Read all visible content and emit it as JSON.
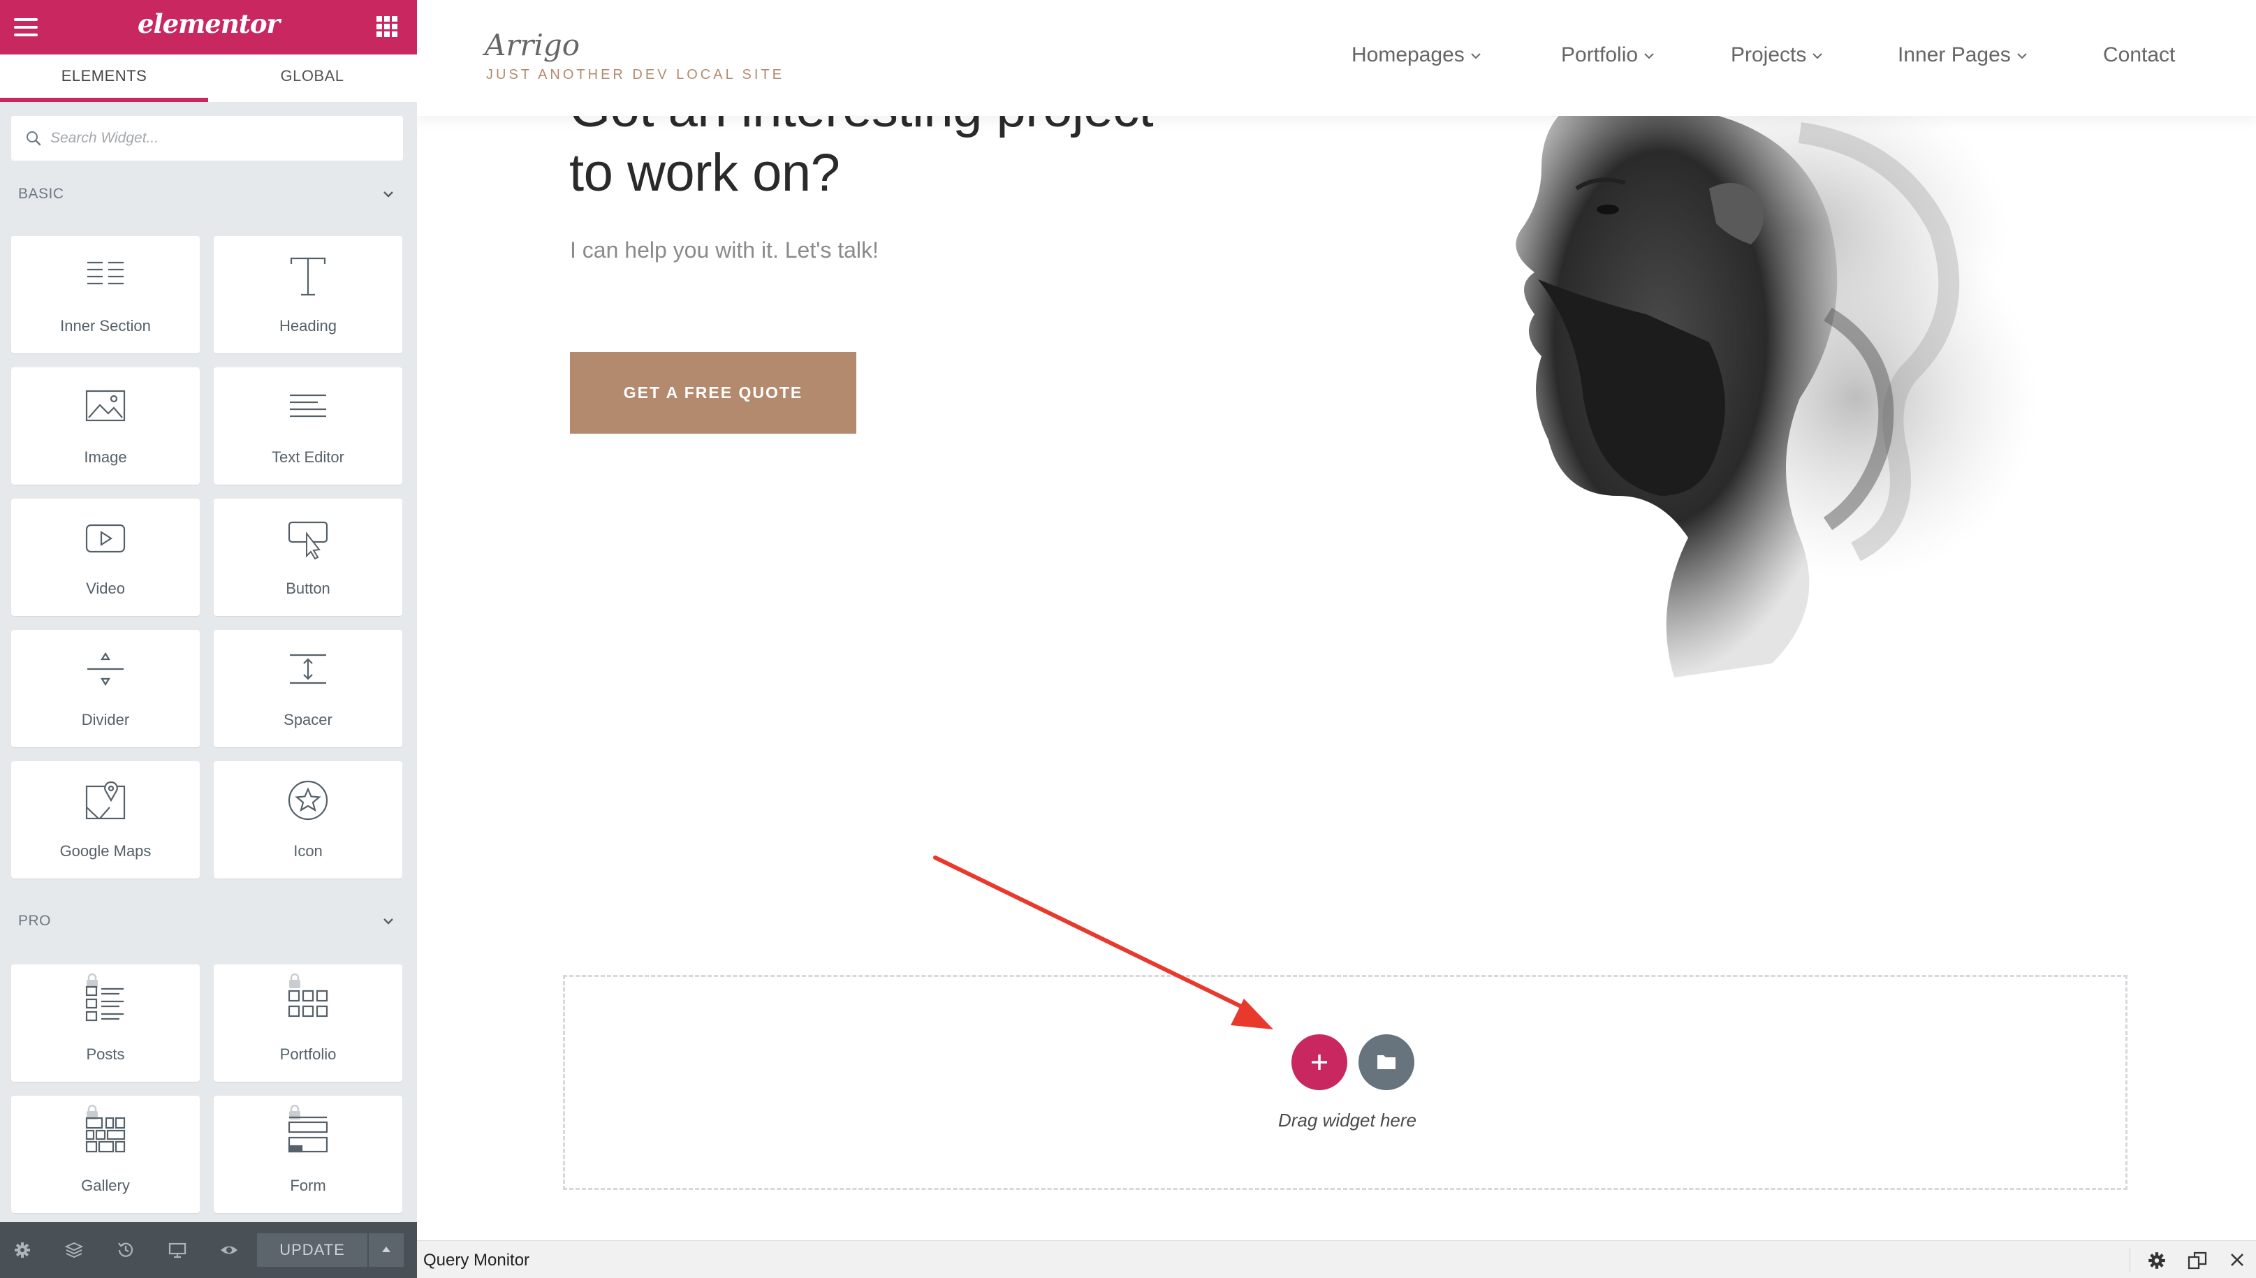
{
  "panel": {
    "logo": "elementor",
    "tabs": [
      {
        "label": "ELEMENTS"
      },
      {
        "label": "GLOBAL"
      }
    ],
    "search": {
      "placeholder": "Search Widget..."
    },
    "categories": [
      {
        "title": "BASIC",
        "widgets": [
          {
            "label": "Inner Section",
            "icon": "inner-section-icon"
          },
          {
            "label": "Heading",
            "icon": "heading-icon"
          },
          {
            "label": "Image",
            "icon": "image-icon"
          },
          {
            "label": "Text Editor",
            "icon": "text-editor-icon"
          },
          {
            "label": "Video",
            "icon": "video-icon"
          },
          {
            "label": "Button",
            "icon": "button-icon"
          },
          {
            "label": "Divider",
            "icon": "divider-icon"
          },
          {
            "label": "Spacer",
            "icon": "spacer-icon"
          },
          {
            "label": "Google Maps",
            "icon": "google-maps-icon"
          },
          {
            "label": "Icon",
            "icon": "star-icon"
          }
        ]
      },
      {
        "title": "PRO",
        "widgets": [
          {
            "label": "Posts",
            "icon": "posts-icon",
            "locked": true
          },
          {
            "label": "Portfolio",
            "icon": "portfolio-icon",
            "locked": true
          },
          {
            "label": "Gallery",
            "icon": "gallery-icon",
            "locked": true
          },
          {
            "label": "Form",
            "icon": "form-icon",
            "locked": true
          }
        ]
      }
    ],
    "footer": {
      "icons": [
        "settings-icon",
        "navigator-icon",
        "history-icon",
        "responsive-icon",
        "preview-icon"
      ],
      "update_label": "UPDATE"
    }
  },
  "site": {
    "title": "Arrigo",
    "tagline": "JUST ANOTHER DEV LOCAL SITE",
    "nav": [
      {
        "label": "Homepages",
        "has_dropdown": true
      },
      {
        "label": "Portfolio",
        "has_dropdown": true
      },
      {
        "label": "Projects",
        "has_dropdown": true
      },
      {
        "label": "Inner Pages",
        "has_dropdown": true
      },
      {
        "label": "Contact",
        "has_dropdown": false
      }
    ]
  },
  "hero": {
    "heading_line1": "Got an interesting project",
    "heading_line2": "to work on?",
    "subtitle": "I can help you with it. Let's talk!",
    "cta_label": "GET A FREE QUOTE"
  },
  "drop_zone": {
    "text": "Drag widget here",
    "add_icon": "plus-icon",
    "template_icon": "folder-icon"
  },
  "query_monitor": {
    "title": "Query Monitor",
    "icons": [
      "gear-icon",
      "dock-toggle-icon",
      "close-icon"
    ]
  },
  "colors": {
    "brand": "#c8275f",
    "panel_bg": "#e6e9ec",
    "footer_bg": "#495157",
    "cta_bg": "#b48a6e",
    "annotation_arrow": "#e8392c"
  }
}
